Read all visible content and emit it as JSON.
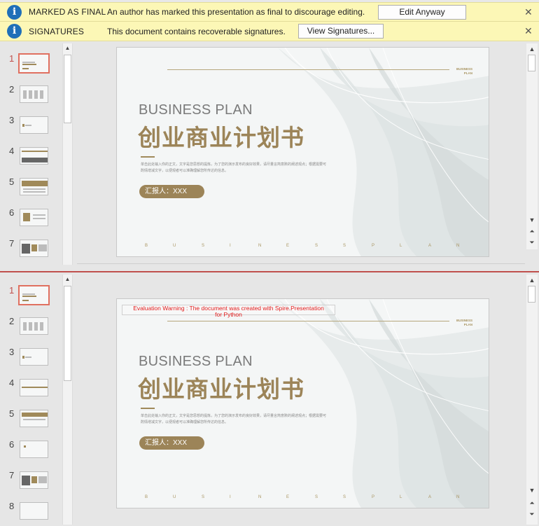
{
  "message_bars": [
    {
      "title": "MARKED AS FINAL",
      "text": "An author has marked this presentation as final to discourage editing.",
      "button": "Edit Anyway",
      "close": "✕"
    },
    {
      "title": "SIGNATURES",
      "text": "This document contains recoverable signatures.",
      "button": "View Signatures...",
      "close": "✕"
    }
  ],
  "pane_one": {
    "thumbnails": [
      "1",
      "2",
      "3",
      "4",
      "5",
      "6",
      "7"
    ],
    "active": "1"
  },
  "pane_two": {
    "thumbnails": [
      "1",
      "2",
      "3",
      "4",
      "5",
      "6",
      "7",
      "8"
    ],
    "active": "1"
  },
  "slide": {
    "corner_label_1": "BUSINESS",
    "corner_label_2": "PLAN",
    "title_en": "BUSINESS PLAN",
    "title_cn": "创业商业计划书",
    "body_1": "单击此处输入你的正文，文字是您思想的提炼，为了您的演示发布的良好效果，请尽量言简意赅的阐述观点；根据需要可",
    "body_2": "酌情增减文字，以便观者可以准确理解您所传达的信息。",
    "reporter": "汇报人：XXX",
    "footer_letters": [
      "B",
      "U",
      "S",
      "I",
      "N",
      "E",
      "S",
      "S",
      "P",
      "L",
      "A",
      "N"
    ]
  },
  "evaluation_warning": {
    "line_1": "Evaluation Warning : The document was created with Spire.Presentation",
    "line_2": "for Python"
  },
  "colors": {
    "accent": "#9c8458",
    "msgbar": "#fcf7b6",
    "info": "#1f6fb8",
    "split": "#c0504d",
    "warning": "#e31b1b"
  }
}
